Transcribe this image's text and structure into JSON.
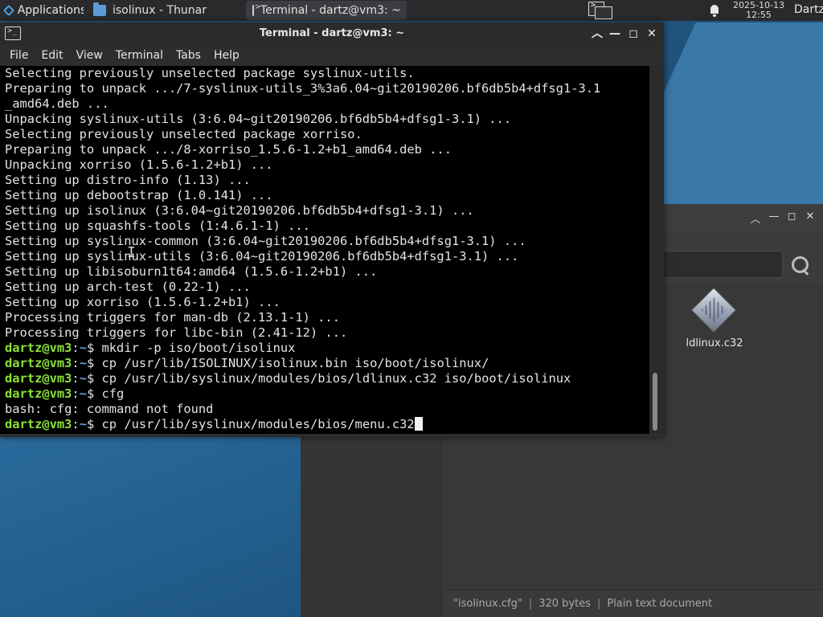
{
  "top_panel": {
    "applications_label": "Applications",
    "tasks": [
      {
        "label": "isolinux - Thunar",
        "icon": "folder-icon"
      },
      {
        "label": "Terminal - dartz@vm3: ~",
        "icon": "terminal-icon"
      }
    ],
    "clock_date": "2025-10-13",
    "clock_time": "12:55",
    "user": "Dartz"
  },
  "terminal": {
    "title": "Terminal - dartz@vm3: ~",
    "menu": [
      "File",
      "Edit",
      "View",
      "Terminal",
      "Tabs",
      "Help"
    ],
    "lines": [
      {
        "type": "out",
        "text": "Selecting previously unselected package syslinux-utils."
      },
      {
        "type": "out",
        "text": "Preparing to unpack .../7-syslinux-utils_3%3a6.04~git20190206.bf6db5b4+dfsg1-3.1"
      },
      {
        "type": "out",
        "text": "_amd64.deb ..."
      },
      {
        "type": "out",
        "text": "Unpacking syslinux-utils (3:6.04~git20190206.bf6db5b4+dfsg1-3.1) ..."
      },
      {
        "type": "out",
        "text": "Selecting previously unselected package xorriso."
      },
      {
        "type": "out",
        "text": "Preparing to unpack .../8-xorriso_1.5.6-1.2+b1_amd64.deb ..."
      },
      {
        "type": "out",
        "text": "Unpacking xorriso (1.5.6-1.2+b1) ..."
      },
      {
        "type": "out",
        "text": "Setting up distro-info (1.13) ..."
      },
      {
        "type": "out",
        "text": "Setting up debootstrap (1.0.141) ..."
      },
      {
        "type": "out",
        "text": "Setting up isolinux (3:6.04~git20190206.bf6db5b4+dfsg1-3.1) ..."
      },
      {
        "type": "out",
        "text": "Setting up squashfs-tools (1:4.6.1-1) ..."
      },
      {
        "type": "out",
        "text": "Setting up syslinux-common (3:6.04~git20190206.bf6db5b4+dfsg1-3.1) ..."
      },
      {
        "type": "out",
        "text": "Setting up syslinux-utils (3:6.04~git20190206.bf6db5b4+dfsg1-3.1) ..."
      },
      {
        "type": "out",
        "text": "Setting up libisoburn1t64:amd64 (1.5.6-1.2+b1) ..."
      },
      {
        "type": "out",
        "text": "Setting up arch-test (0.22-1) ..."
      },
      {
        "type": "out",
        "text": "Setting up xorriso (1.5.6-1.2+b1) ..."
      },
      {
        "type": "out",
        "text": "Processing triggers for man-db (2.13.1-1) ..."
      },
      {
        "type": "out",
        "text": "Processing triggers for libc-bin (2.41-12) ..."
      },
      {
        "type": "cmd",
        "user": "dartz@vm3",
        "path": "~",
        "text": "mkdir -p iso/boot/isolinux"
      },
      {
        "type": "cmd",
        "user": "dartz@vm3",
        "path": "~",
        "text": "cp /usr/lib/ISOLINUX/isolinux.bin iso/boot/isolinux/"
      },
      {
        "type": "cmd",
        "user": "dartz@vm3",
        "path": "~",
        "text": "cp /usr/lib/syslinux/modules/bios/ldlinux.c32 iso/boot/isolinux"
      },
      {
        "type": "cmd",
        "user": "dartz@vm3",
        "path": "~",
        "text": "cfg"
      },
      {
        "type": "out",
        "text": "bash: cfg: command not found"
      },
      {
        "type": "cmd",
        "user": "dartz@vm3",
        "path": "~",
        "text": "cp /usr/lib/syslinux/modules/bios/menu.c32",
        "cursor": true
      }
    ]
  },
  "thunar": {
    "file": {
      "name": "ldlinux.c32",
      "icon": "binary-file-icon"
    },
    "status": {
      "selected": "\"isolinux.cfg\"",
      "size": "320 bytes",
      "kind": "Plain text document"
    }
  },
  "colors": {
    "prompt_user": "#8ae234",
    "prompt_path": "#729fcf",
    "terminal_bg": "#000000"
  }
}
